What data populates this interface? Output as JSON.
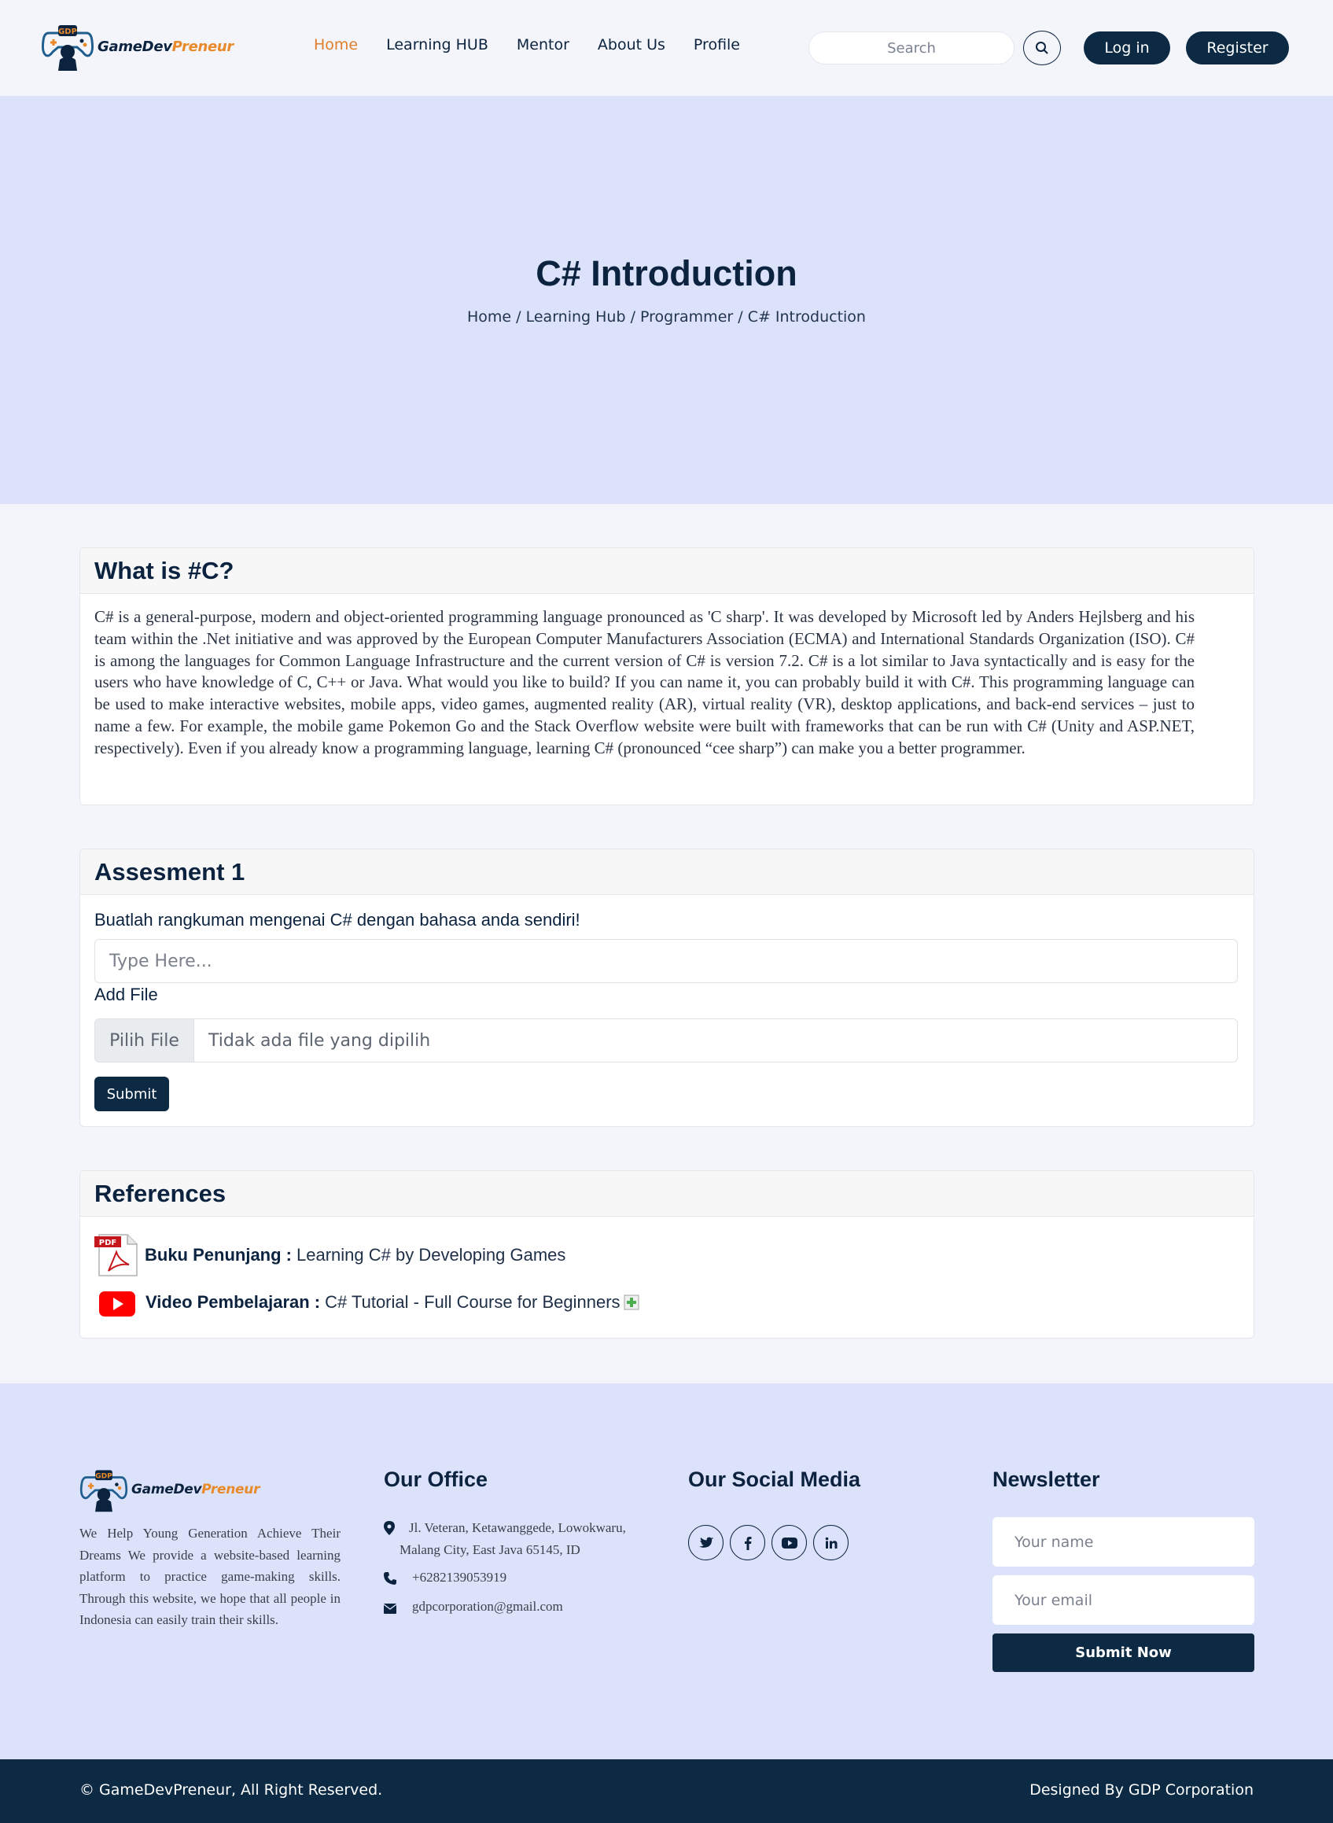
{
  "brand": {
    "name_part1": "GameDev",
    "name_part2": "Preneur",
    "logo_badge": "GDP"
  },
  "nav": {
    "items": [
      {
        "label": "Home"
      },
      {
        "label": "Learning HUB"
      },
      {
        "label": "Mentor"
      },
      {
        "label": "About Us"
      },
      {
        "label": "Profile"
      }
    ],
    "active_item": "Home",
    "search_placeholder": "Search",
    "login_label": "Log in",
    "register_label": "Register"
  },
  "hero": {
    "title": "C# Introduction",
    "breadcrumb": [
      "Home",
      "Learning Hub",
      "Programmer",
      "C# Introduction"
    ],
    "breadcrumb_separator": " / "
  },
  "intro": {
    "heading": "What is #C?",
    "body": "C# is a general-purpose, modern and object-oriented programming language pronounced as 'C sharp'. It was developed by Microsoft led by Anders Hejlsberg and his team within the .Net initiative and was approved by the European Computer Manufacturers Association (ECMA) and International Standards Organization (ISO). C# is among the languages for Common Language Infrastructure and the current version of C# is version 7.2. C# is a lot similar to Java syntactically and is easy for the users who have knowledge of C, C++ or Java. What would you like to build? If you can name it, you can probably build it with C#. This programming language can be used to make interactive websites, mobile apps, video games, augmented reality (AR), virtual reality (VR), desktop applications, and back-end services – just to name a few. For example, the mobile game Pokemon Go and the Stack Overflow website were built with frameworks that can be run with C# (Unity and ASP.NET, respectively). Even if you already know a programming language, learning C# (pronounced “cee sharp”) can make you a better programmer."
  },
  "assessment": {
    "heading": "Assesment 1",
    "prompt": "Buatlah rangkuman mengenai C# dengan bahasa anda sendiri!",
    "answer_placeholder": "Type Here...",
    "add_file_label": "Add File",
    "file_button": "Pilih File",
    "file_status": "Tidak ada file yang dipilih",
    "submit_label": "Submit"
  },
  "references": {
    "heading": "References",
    "items": [
      {
        "icon": "pdf-icon",
        "label": "Buku Penunjang :",
        "title": "Learning C# by Developing Games"
      },
      {
        "icon": "youtube-icon",
        "label": "Video Pembelajaran :",
        "title": "C# Tutorial - Full Course for Beginners"
      }
    ]
  },
  "footer": {
    "about": "We Help Young Generation Achieve Their Dreams We provide a website-based learning platform to practice game-making skills. Through this website, we hope that all people in Indonesia can easily train their skills.",
    "office": {
      "heading": "Our Office",
      "address": "Jl. Veteran, Ketawanggede, Lowokwaru, Malang City, East Java 65145, ID",
      "phone": "+6282139053919",
      "email": "gdpcorporation@gmail.com"
    },
    "social": {
      "heading": "Our Social Media",
      "icons": [
        "twitter-icon",
        "facebook-icon",
        "youtube-icon",
        "linkedin-icon"
      ]
    },
    "newsletter": {
      "heading": "Newsletter",
      "name_placeholder": "Your name",
      "email_placeholder": "Your email",
      "submit_label": "Submit Now"
    },
    "copyright": "© GameDevPreneur, All Right Reserved.",
    "designed_by": "Designed By GDP Corporation"
  },
  "colors": {
    "navy": "#0c2a44",
    "accent_orange": "#e07e2c",
    "hero_bg": "#dde2fb",
    "page_bg": "#f4f5fa"
  }
}
